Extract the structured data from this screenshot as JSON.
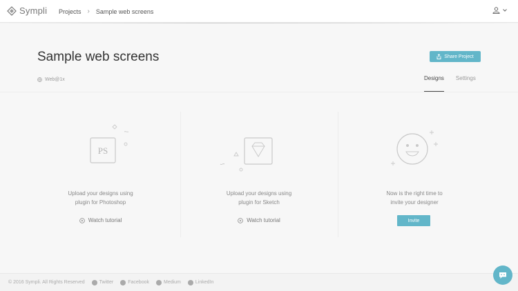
{
  "header": {
    "brand": "Sympli",
    "breadcrumbs": [
      "Projects",
      "Sample web screens"
    ]
  },
  "page": {
    "title": "Sample web screens",
    "platform": "Web@1x",
    "share_label": "Share Project",
    "tabs": [
      {
        "label": "Designs",
        "active": true
      },
      {
        "label": "Settings",
        "active": false
      }
    ]
  },
  "columns": {
    "photoshop": {
      "icon_text": "PS",
      "line1": "Upload your designs using",
      "line2": "plugin for Photoshop",
      "watch_label": "Watch tutorial"
    },
    "sketch": {
      "line1": "Upload your designs using",
      "line2": "plugin for Sketch",
      "watch_label": "Watch tutorial"
    },
    "invite": {
      "line1": "Now is the right time to",
      "line2": "invite your designer",
      "button_label": "Invite"
    }
  },
  "footer": {
    "copyright": "© 2016 Sympli. All Rights Reserved",
    "links": [
      "Twitter",
      "Facebook",
      "Medium",
      "LinkedIn"
    ]
  },
  "colors": {
    "accent": "#62b6c9"
  }
}
